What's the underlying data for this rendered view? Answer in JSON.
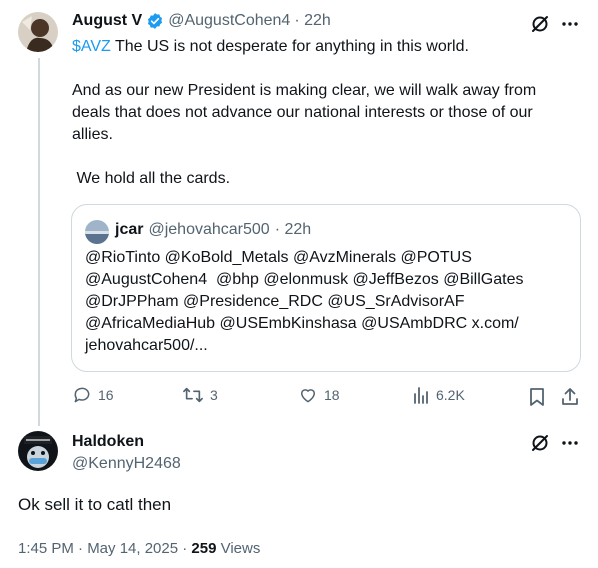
{
  "colors": {
    "accent": "#1d9bf0",
    "muted": "#536471",
    "text": "#0f1419",
    "border": "#cfd9de"
  },
  "post1": {
    "display_name": "August V",
    "handle": "@AugustCohen4",
    "time": "· 22h",
    "cashtag": "$AVZ",
    "line1_rest": " The US is not desperate for anything in this world.",
    "para2_line1": "And as our new President is making clear, we will walk away from",
    "para2_line2": "deals that does not advance our national interests or those of our",
    "para2_line3": "allies.",
    "para3": " We hold all the cards.",
    "quote": {
      "display_name": "jcar",
      "handle": "@jehovahcar500",
      "time": "· 22h",
      "line1": "@RioTinto @KoBold_Metals @AvzMinerals @POTUS",
      "line2": "@AugustCohen4  @bhp @elonmusk @JeffBezos @BillGates",
      "line3": "@DrJPPham @Presidence_RDC @US_SrAdvisorAF",
      "line4": "@AfricaMediaHub @USEmbKinshasa @USAmbDRC x.com/",
      "line5": "jehovahcar500/..."
    },
    "actions": {
      "replies": "16",
      "reposts": "3",
      "likes": "18",
      "views": "6.2K"
    }
  },
  "post2": {
    "display_name": "Haldoken",
    "handle": "@KennyH2468",
    "text": "Ok sell it to catl then",
    "time": "1:45 PM · May 14, 2025 · ",
    "views_count": "259",
    "views_label": " Views"
  }
}
